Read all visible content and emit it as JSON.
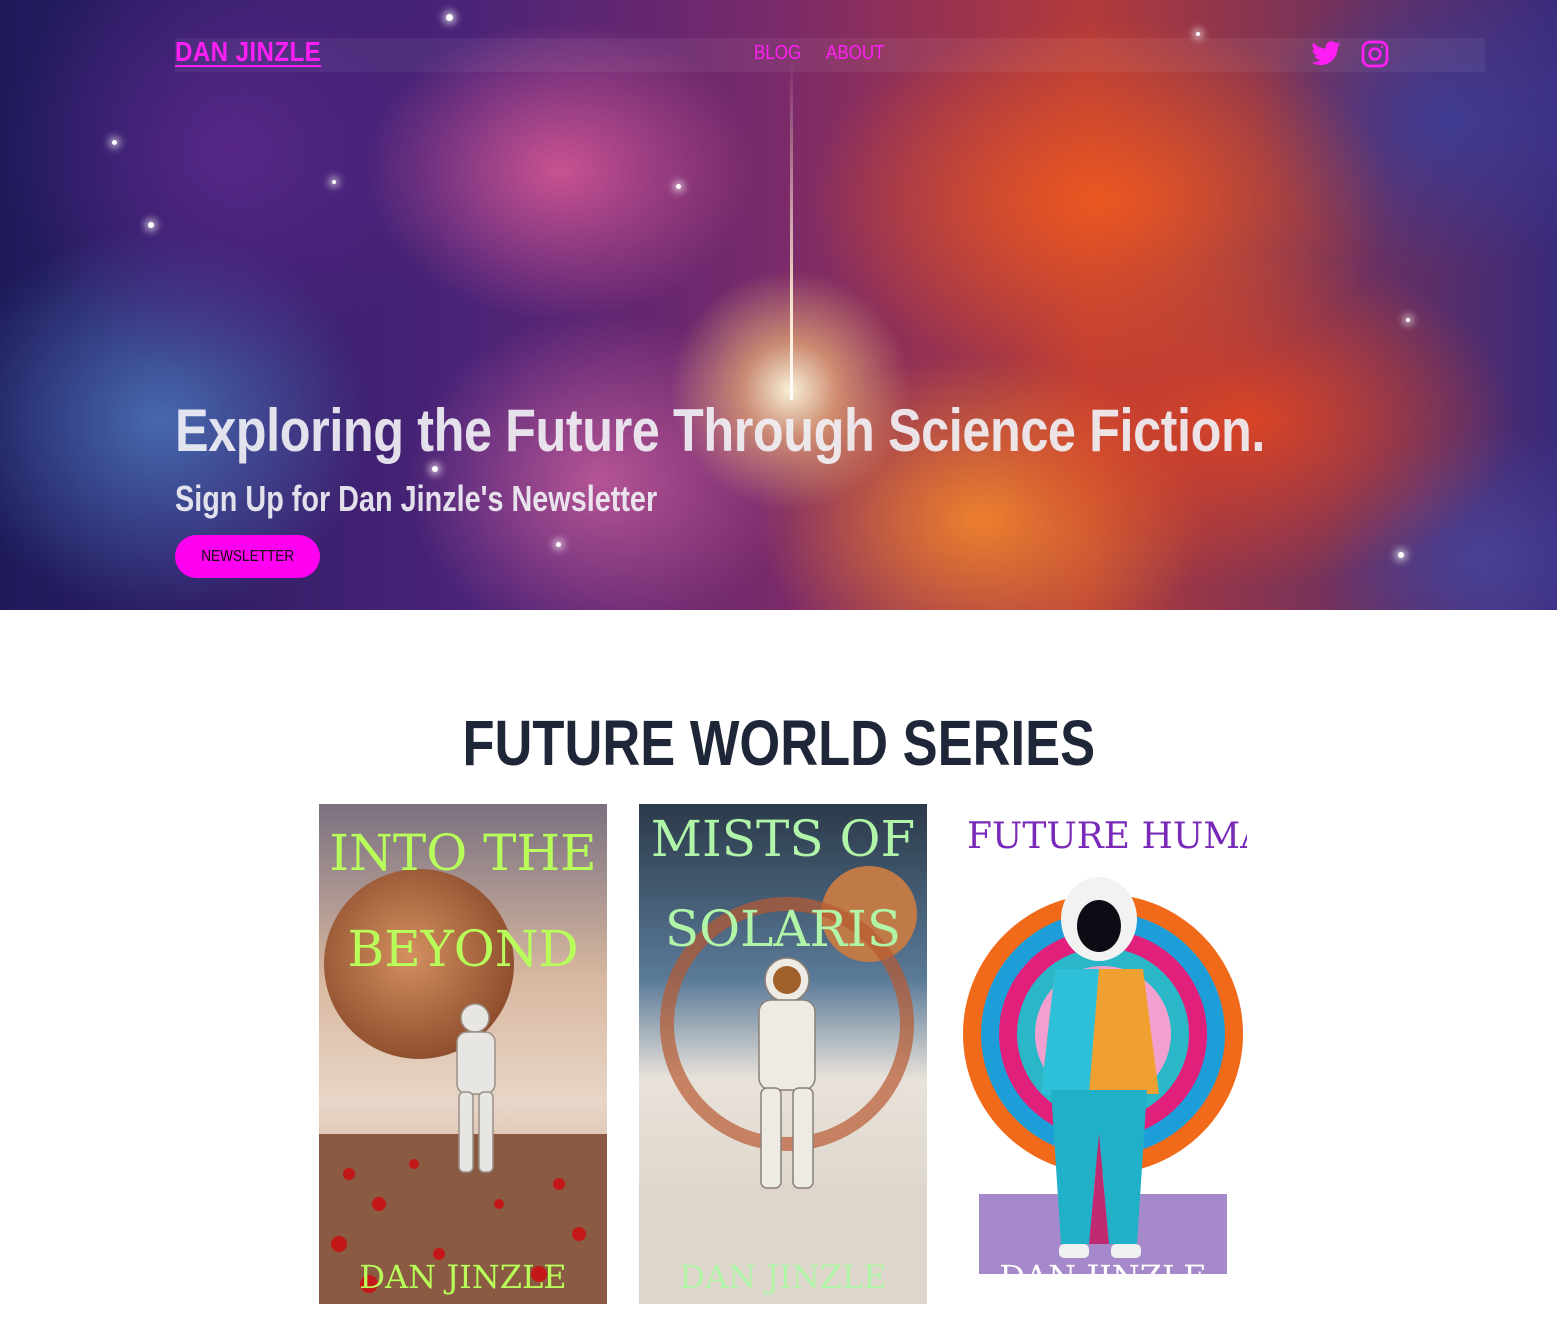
{
  "site": {
    "brand": "DAN JINZLE",
    "nav": [
      {
        "label": "BLOG"
      },
      {
        "label": "ABOUT"
      }
    ],
    "social": [
      {
        "icon": "twitter-icon"
      },
      {
        "icon": "instagram-icon"
      }
    ],
    "accent_color": "#ff1ff5"
  },
  "hero": {
    "headline": "Exploring the Future Through Science Fiction.",
    "subheadline": "Sign Up for Dan Jinzle's Newsletter",
    "button_label": "NEWSLETTER"
  },
  "series": {
    "title": "FUTURE WORLD SERIES",
    "books": [
      {
        "title_line1": "INTO THE",
        "title_line2": "BEYOND",
        "author": "DAN JINZLE"
      },
      {
        "title_line1": "MISTS OF",
        "title_line2": "SOLARIS",
        "author": "DAN JINZLE"
      },
      {
        "title_line1": "FUTURE HUMAN",
        "author": "DAN JINZLE"
      }
    ]
  }
}
